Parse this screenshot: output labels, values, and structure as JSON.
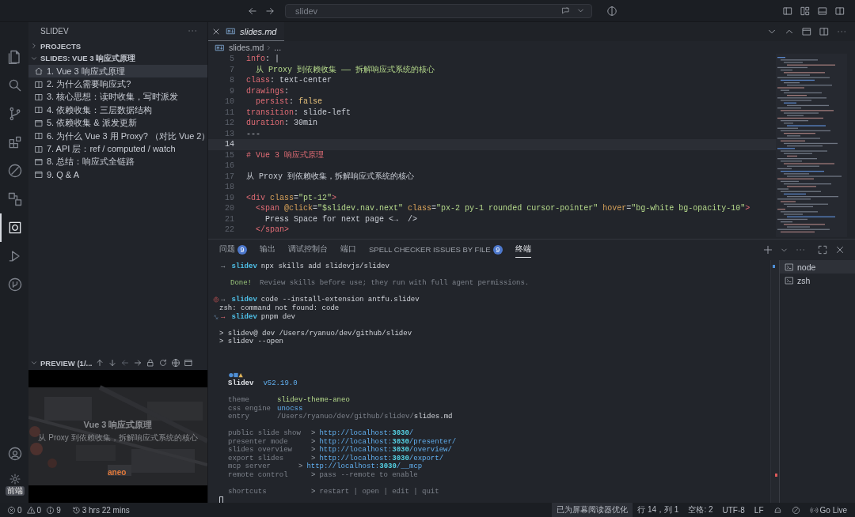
{
  "title_bar": {
    "search": {
      "value": "slidev"
    }
  },
  "activity_bar": {
    "items": [
      {
        "kind": "explorer",
        "selected": false
      },
      {
        "kind": "search",
        "selected": false
      },
      {
        "kind": "source-control",
        "selected": false
      },
      {
        "kind": "extensions",
        "selected": false
      },
      {
        "kind": "chat",
        "selected": false
      },
      {
        "kind": "remote",
        "selected": false
      },
      {
        "kind": "slidev",
        "selected": true
      },
      {
        "kind": "run",
        "selected": false
      },
      {
        "kind": "git-graph",
        "selected": false
      }
    ],
    "settings_badge": "前端"
  },
  "sidebar": {
    "title": "SLIDEV",
    "sections": [
      {
        "label": "PROJECTS",
        "expanded": false
      },
      {
        "label": "SLIDES: VUE 3 响应式原理",
        "expanded": true,
        "items": [
          {
            "label": "1. Vue 3 响应式原理",
            "kind": "cover",
            "selected": true
          },
          {
            "label": "2. 为什么需要响应式?",
            "kind": "two-cols",
            "selected": false
          },
          {
            "label": "3. 核心思想：读时收集，写时派发",
            "kind": "two-cols",
            "selected": false
          },
          {
            "label": "4. 依赖收集：三层数据结构",
            "kind": "two-cols",
            "selected": false
          },
          {
            "label": "5. 依赖收集 & 派发更新",
            "kind": "default",
            "selected": false
          },
          {
            "label": "6. 为什么 Vue 3 用 Proxy? （对比 Vue 2）",
            "kind": "two-cols",
            "selected": false
          },
          {
            "label": "7. API 层：ref / computed / watch",
            "kind": "two-cols",
            "selected": false
          },
          {
            "label": "8. 总结：响应式全链路",
            "kind": "default",
            "selected": false
          },
          {
            "label": "9. Q & A",
            "kind": "default",
            "selected": false
          }
        ]
      }
    ],
    "preview": {
      "label": "PREVIEW (1/...",
      "expanded": true,
      "slide": {
        "title": "Vue 3 响应式原理",
        "subtitle": "从 Proxy 到依赖收集，拆解响应式系统的核心",
        "brand": "aneo"
      }
    }
  },
  "editor": {
    "tabs": [
      {
        "label": "slides.md",
        "selected": true
      }
    ],
    "breadcrumb": [
      "slides.md",
      "..."
    ],
    "lines": [
      {
        "number": "5",
        "current": false,
        "tokens": [
          {
            "kind": "key",
            "text": "info"
          },
          {
            "kind": "punct",
            "text": ": |"
          }
        ]
      },
      {
        "number": "7",
        "current": false,
        "tokens": [
          {
            "kind": "string",
            "text": "  从 Proxy 到依赖收集 —— 拆解响应式系统的核心"
          }
        ]
      },
      {
        "number": "8",
        "current": false,
        "tokens": [
          {
            "kind": "key",
            "text": "class"
          },
          {
            "kind": "punct",
            "text": ": "
          },
          {
            "kind": "value",
            "text": "text-center"
          }
        ]
      },
      {
        "number": "9",
        "current": false,
        "tokens": [
          {
            "kind": "key",
            "text": "drawings"
          },
          {
            "kind": "punct",
            "text": ":"
          }
        ]
      },
      {
        "number": "10",
        "current": false,
        "tokens": [
          {
            "kind": "key",
            "text": "  persist"
          },
          {
            "kind": "punct",
            "text": ": "
          },
          {
            "kind": "bool",
            "text": "false"
          }
        ]
      },
      {
        "number": "11",
        "current": false,
        "tokens": [
          {
            "kind": "key",
            "text": "transition"
          },
          {
            "kind": "punct",
            "text": ": "
          },
          {
            "kind": "value",
            "text": "slide-left"
          }
        ]
      },
      {
        "number": "12",
        "current": false,
        "tokens": [
          {
            "kind": "key",
            "text": "duration"
          },
          {
            "kind": "punct",
            "text": ": "
          },
          {
            "kind": "value",
            "text": "30min"
          }
        ]
      },
      {
        "number": "13",
        "current": false,
        "tokens": [
          {
            "kind": "punct",
            "text": "---"
          }
        ]
      },
      {
        "number": "14",
        "current": true
      },
      {
        "number": "15",
        "current": false,
        "tokens": [
          {
            "kind": "heading",
            "text": "# Vue 3 响应式原理"
          }
        ]
      },
      {
        "number": "16",
        "current": false
      },
      {
        "number": "17",
        "current": false,
        "tokens": [
          {
            "kind": "text",
            "text": "从 Proxy 到依赖收集，拆解响应式系统的核心"
          }
        ]
      },
      {
        "number": "18",
        "current": false
      },
      {
        "number": "19",
        "current": false,
        "tokens": [
          {
            "kind": "tag",
            "text": "<div"
          },
          {
            "kind": "attr",
            "text": " class"
          },
          {
            "kind": "punct",
            "text": "="
          },
          {
            "kind": "string",
            "text": "\"pt-12\""
          },
          {
            "kind": "tag",
            "text": ">"
          }
        ]
      },
      {
        "number": "20",
        "current": false,
        "tokens": [
          {
            "kind": "tag",
            "text": "  <span"
          },
          {
            "kind": "attr",
            "text": " @click"
          },
          {
            "kind": "punct",
            "text": "="
          },
          {
            "kind": "string",
            "text": "\"$slidev.nav.next\""
          },
          {
            "kind": "attr",
            "text": " class"
          },
          {
            "kind": "punct",
            "text": "="
          },
          {
            "kind": "string",
            "text": "\"px-2 py-1 rounded cursor-pointer\""
          },
          {
            "kind": "attr",
            "text": " hover"
          },
          {
            "kind": "punct",
            "text": "="
          },
          {
            "kind": "string",
            "text": "\"bg-white bg-opacity-10\""
          },
          {
            "kind": "tag",
            "text": ">"
          }
        ]
      },
      {
        "number": "21",
        "current": false,
        "tokens": [
          {
            "kind": "text",
            "text": "    Press Space for next page <→  />"
          }
        ]
      },
      {
        "number": "22",
        "current": false,
        "tokens": [
          {
            "kind": "tag",
            "text": "  </span>"
          }
        ]
      }
    ]
  },
  "panel": {
    "tabs": [
      {
        "label": "问题",
        "badge": "9",
        "selected": false
      },
      {
        "label": "输出",
        "selected": false
      },
      {
        "label": "调试控制台",
        "selected": false
      },
      {
        "label": "端口",
        "selected": false
      },
      {
        "label": "SPELL CHECKER ISSUES BY FILE",
        "badge": "9",
        "selected": false
      },
      {
        "label": "终端",
        "selected": true
      }
    ],
    "terminal_lines": [
      {
        "kind": "prompt",
        "tokens": [
          {
            "kind": "arrow",
            "text": "→"
          },
          {
            "kind": "dir",
            "text": "slidev"
          },
          {
            "kind": "text",
            "text": "npx skills add slidevjs/slidev"
          }
        ]
      },
      {
        "kind": "blank"
      },
      {
        "kind": "output",
        "tokens": [
          {
            "kind": "done",
            "text": "Done!"
          },
          {
            "kind": "dim",
            "text": "Review skills before use; they run with full agent permissions."
          }
        ]
      },
      {
        "kind": "blank"
      },
      {
        "kind": "error-prompt",
        "tokens": [
          {
            "kind": "arrow",
            "text": "→"
          },
          {
            "kind": "dir",
            "text": "slidev"
          },
          {
            "kind": "text",
            "text": "code --install-extension antfu.slidev"
          }
        ]
      },
      {
        "kind": "output",
        "tokens": [
          {
            "kind": "text",
            "text": "zsh: command not found: code"
          }
        ]
      },
      {
        "kind": "running-prompt",
        "tokens": [
          {
            "kind": "arrow-error",
            "text": "→"
          },
          {
            "kind": "dir",
            "text": "slidev"
          },
          {
            "kind": "text",
            "text": "pnpm dev"
          }
        ]
      },
      {
        "kind": "blank"
      },
      {
        "kind": "output",
        "tokens": [
          {
            "kind": "text",
            "text": "> slidev@ dev /Users/ryanuo/dev/github/slidev"
          }
        ]
      },
      {
        "kind": "output",
        "tokens": [
          {
            "kind": "text",
            "text": "> slidev --open"
          }
        ]
      },
      {
        "kind": "blank"
      },
      {
        "kind": "blank"
      },
      {
        "kind": "blank"
      },
      {
        "kind": "logo"
      },
      {
        "kind": "output",
        "tokens": [
          {
            "kind": "brand",
            "text": "Slidev"
          },
          {
            "kind": "version",
            "text": "v52.19.0"
          }
        ]
      },
      {
        "kind": "blank"
      },
      {
        "kind": "output",
        "tokens": [
          {
            "kind": "label",
            "text": "theme"
          },
          {
            "kind": "green",
            "text": "slidev-theme-aneo"
          }
        ]
      },
      {
        "kind": "output",
        "tokens": [
          {
            "kind": "label",
            "text": "css engine"
          },
          {
            "kind": "blue",
            "text": "unocss"
          }
        ]
      },
      {
        "kind": "output",
        "tokens": [
          {
            "kind": "label",
            "text": "entry"
          },
          {
            "kind": "dim",
            "text": "/Users/ryanuo/dev/github/slidev/"
          },
          {
            "kind": "text",
            "text": "slides.md"
          }
        ]
      },
      {
        "kind": "blank"
      },
      {
        "kind": "output",
        "tokens": [
          {
            "kind": "label-wide",
            "text": "public slide show"
          },
          {
            "kind": "gt",
            "text": ">"
          },
          {
            "kind": "link",
            "text": "http://localhost:"
          },
          {
            "kind": "link-bold",
            "text": "3030"
          },
          {
            "kind": "link",
            "text": "/"
          }
        ]
      },
      {
        "kind": "output",
        "tokens": [
          {
            "kind": "label-wide",
            "text": "presenter mode"
          },
          {
            "kind": "gt",
            "text": ">"
          },
          {
            "kind": "link",
            "text": "http://localhost:"
          },
          {
            "kind": "link-bold",
            "text": "3030"
          },
          {
            "kind": "link",
            "text": "/presenter/"
          }
        ]
      },
      {
        "kind": "output",
        "tokens": [
          {
            "kind": "label-wide",
            "text": "slides overview"
          },
          {
            "kind": "gt",
            "text": ">"
          },
          {
            "kind": "link",
            "text": "http://localhost:"
          },
          {
            "kind": "link-bold",
            "text": "3030"
          },
          {
            "kind": "link",
            "text": "/overview/"
          }
        ]
      },
      {
        "kind": "output",
        "tokens": [
          {
            "kind": "label-wide",
            "text": "export slides"
          },
          {
            "kind": "gt",
            "text": ">"
          },
          {
            "kind": "link",
            "text": "http://localhost:"
          },
          {
            "kind": "link-bold",
            "text": "3030"
          },
          {
            "kind": "link",
            "text": "/export/"
          }
        ]
      },
      {
        "kind": "output",
        "tokens": [
          {
            "kind": "label-mid",
            "text": "mcp server"
          },
          {
            "kind": "gt",
            "text": ">"
          },
          {
            "kind": "link",
            "text": "http://localhost:"
          },
          {
            "kind": "link-bold",
            "text": "3030"
          },
          {
            "kind": "link",
            "text": "/__mcp"
          }
        ]
      },
      {
        "kind": "output",
        "tokens": [
          {
            "kind": "label-wide",
            "text": "remote control"
          },
          {
            "kind": "gt",
            "text": ">"
          },
          {
            "kind": "dim",
            "text": "pass --remote to enable"
          }
        ]
      },
      {
        "kind": "blank"
      },
      {
        "kind": "output",
        "tokens": [
          {
            "kind": "label-wide",
            "text": "shortcuts"
          },
          {
            "kind": "gt",
            "text": ">"
          },
          {
            "kind": "dim",
            "text": "restart | open | edit | quit"
          }
        ]
      },
      {
        "kind": "cursor"
      }
    ],
    "terminals": [
      {
        "label": "node",
        "selected": true
      },
      {
        "label": "zsh",
        "selected": false
      }
    ]
  },
  "status_bar": {
    "left": [
      {
        "kind": "errors",
        "text": "0"
      },
      {
        "kind": "warnings",
        "text": "0"
      },
      {
        "kind": "info",
        "text": "9"
      },
      {
        "kind": "history",
        "text": "3 hrs 22 mins"
      }
    ],
    "right": [
      {
        "kind": "text",
        "text": "已为屏幕阅读器优化",
        "highlighted": true
      },
      {
        "kind": "text",
        "text": "行 14，列 1",
        "highlighted": false
      },
      {
        "kind": "text",
        "text": "空格: 2",
        "highlighted": false
      },
      {
        "kind": "text",
        "text": "UTF-8",
        "highlighted": false
      },
      {
        "kind": "text",
        "text": "LF",
        "highlighted": false
      },
      {
        "kind": "copilot",
        "highlighted": false
      },
      {
        "kind": "feedback",
        "highlighted": false
      },
      {
        "kind": "live",
        "text": "Go Live",
        "highlighted": false
      }
    ]
  }
}
